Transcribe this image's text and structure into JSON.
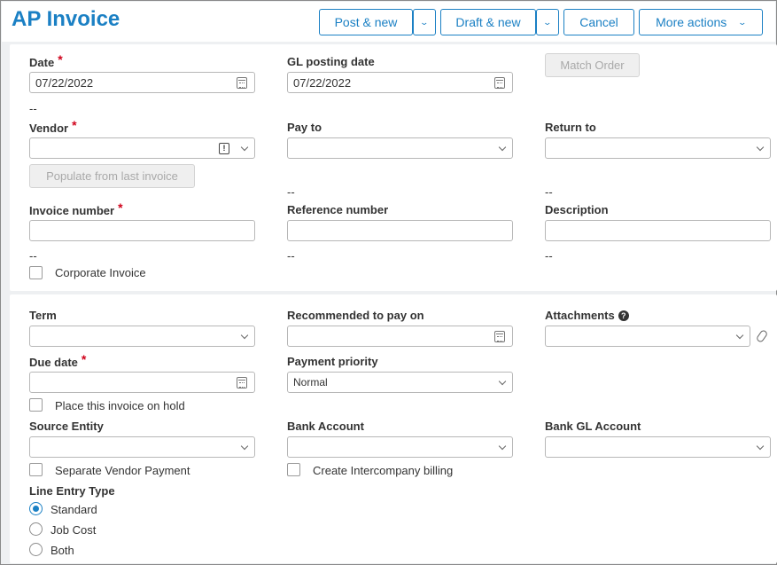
{
  "page": {
    "title": "AP Invoice"
  },
  "toolbar": {
    "post_new": "Post & new",
    "draft_new": "Draft & new",
    "cancel": "Cancel",
    "more_actions": "More actions"
  },
  "section1": {
    "date": {
      "label": "Date",
      "value": "07/22/2022"
    },
    "gl_posting_date": {
      "label": "GL posting date",
      "value": "07/22/2022"
    },
    "match_order": "Match Order",
    "date_note": "--",
    "vendor": {
      "label": "Vendor",
      "value": ""
    },
    "pay_to": {
      "label": "Pay to",
      "value": ""
    },
    "return_to": {
      "label": "Return to",
      "value": ""
    },
    "populate_button": "Populate from last invoice",
    "pay_to_note": "--",
    "return_to_note": "--",
    "invoice_number": {
      "label": "Invoice number",
      "value": ""
    },
    "reference_number": {
      "label": "Reference number",
      "value": ""
    },
    "description": {
      "label": "Description",
      "value": ""
    },
    "invoice_note": "--",
    "reference_note": "--",
    "description_note": "--",
    "corporate_invoice": "Corporate Invoice",
    "required_marker": "*"
  },
  "section2": {
    "term": {
      "label": "Term",
      "value": ""
    },
    "recommended_pay_on": {
      "label": "Recommended to pay on",
      "value": ""
    },
    "attachments": {
      "label": "Attachments",
      "value": ""
    },
    "due_date": {
      "label": "Due date",
      "value": ""
    },
    "payment_priority": {
      "label": "Payment priority",
      "value": "Normal"
    },
    "hold": "Place this invoice on hold",
    "source_entity": {
      "label": "Source Entity",
      "value": ""
    },
    "bank_account": {
      "label": "Bank Account",
      "value": ""
    },
    "bank_gl_account": {
      "label": "Bank GL Account",
      "value": ""
    },
    "separate_vendor_payment": "Separate Vendor Payment",
    "create_intercompany_billing": "Create Intercompany billing",
    "line_entry_type": {
      "label": "Line Entry Type",
      "options": [
        "Standard",
        "Job Cost",
        "Both"
      ],
      "selected": "Standard"
    }
  },
  "colors": {
    "accent": "#1b80c4",
    "required": "#d0021b"
  }
}
